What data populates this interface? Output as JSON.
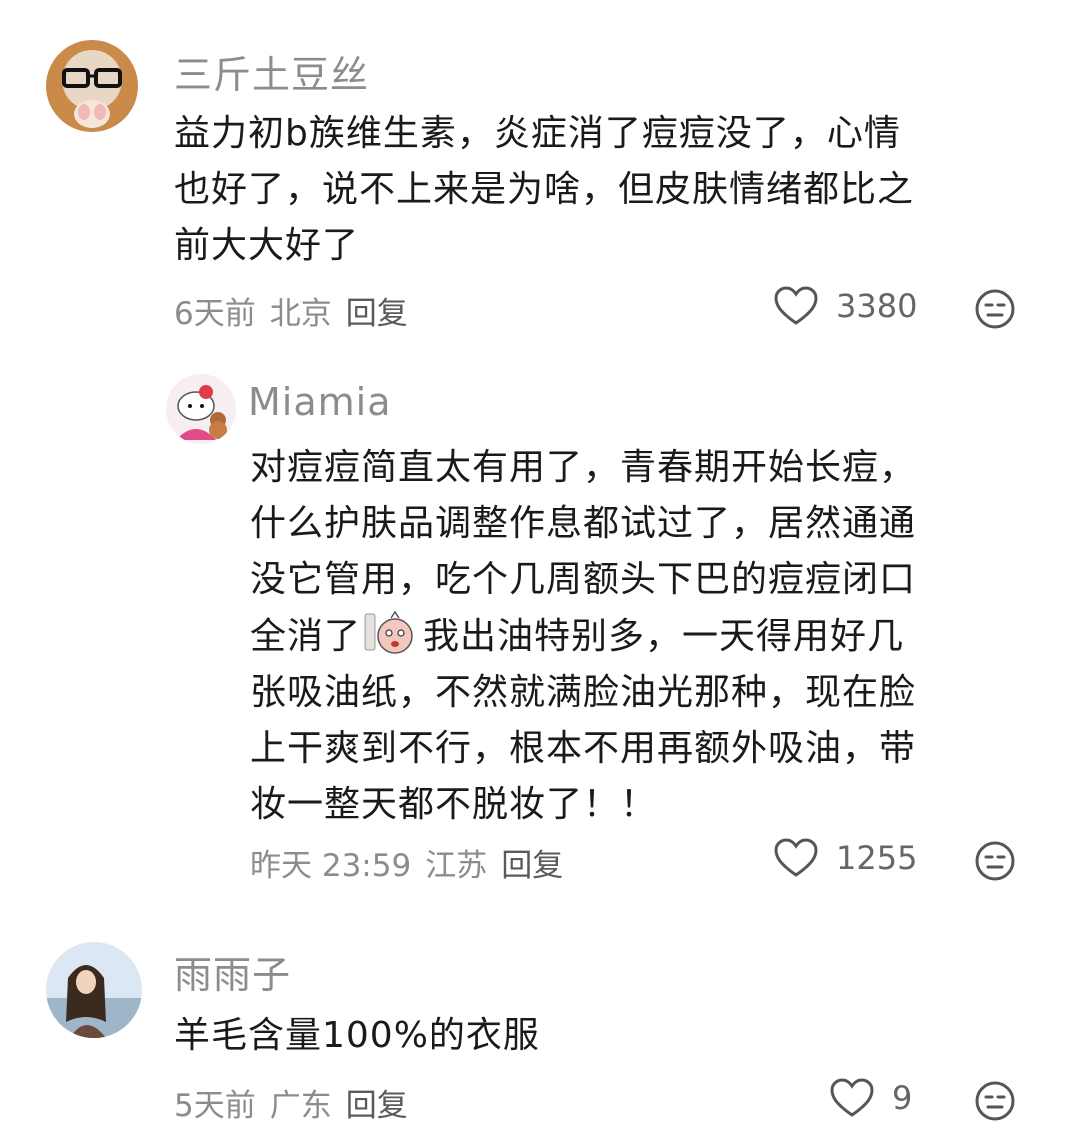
{
  "comments": [
    {
      "username": "三斤土豆丝",
      "lines": [
        "益力初b族维生素，炎症消了痘痘没了，心情",
        "也好了，说不上来是为啥，但皮肤情绪都比之",
        "前大大好了"
      ],
      "time": "6天前",
      "location": "北京",
      "reply_label": "回复",
      "likes": "3380"
    },
    {
      "username": "Miamia",
      "lines": [
        "对痘痘简直太有用了，青春期开始长痘，",
        "什么护肤品调整作息都试过了，居然通通",
        "没它管用，吃个几周额头下巴的痘痘闭口"
      ],
      "line4_before": "全消了",
      "line4_after": "我出油特别多，一天得用好几",
      "lines_tail": [
        "张吸油纸，不然就满脸油光那种，现在脸",
        "上干爽到不行，根本不用再额外吸油，带",
        "妆一整天都不脱妆了！！"
      ],
      "time": "昨天 23:59",
      "location": "江苏",
      "reply_label": "回复",
      "likes": "1255"
    },
    {
      "username": "雨雨子",
      "lines": [
        "羊毛含量100%的衣服"
      ],
      "time": "5天前",
      "location": "广东",
      "reply_label": "回复",
      "likes": "9"
    }
  ],
  "icons": {
    "like": "heart-outline-icon",
    "dislike": "neutral-face-icon",
    "inline_emoji": "sticker-emoji-icon"
  }
}
